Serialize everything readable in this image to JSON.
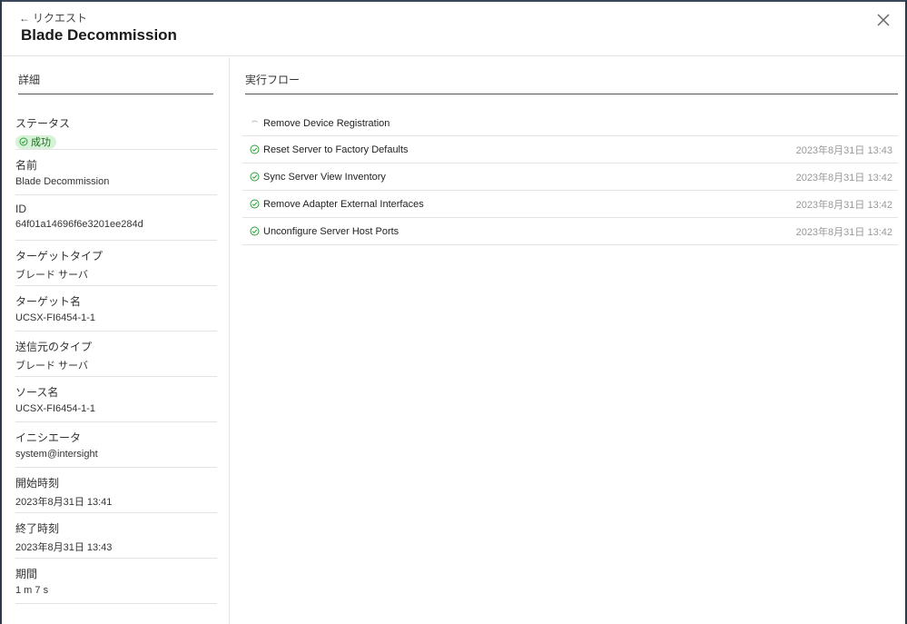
{
  "header": {
    "back_label": "リクエスト",
    "title": "Blade Decommission"
  },
  "details": {
    "heading": "詳細",
    "status": {
      "label": "ステータス",
      "value": "成功"
    },
    "fields": [
      {
        "label": "名前",
        "value": "Blade Decommission"
      },
      {
        "label": "ID",
        "value": "64f01a14696f6e3201ee284d"
      },
      {
        "label": "ターゲットタイプ",
        "value": "ブレード サーバ"
      },
      {
        "label": "ターゲット名",
        "value": "UCSX-FI6454-1-1"
      },
      {
        "label": "送信元のタイプ",
        "value": "ブレード サーバ"
      },
      {
        "label": "ソース名",
        "value": "UCSX-FI6454-1-1"
      },
      {
        "label": "イニシエータ",
        "value": "system@intersight"
      },
      {
        "label": "開始時刻",
        "value": "2023年8月31日 13:41"
      },
      {
        "label": "終了時刻",
        "value": "2023年8月31日 13:43"
      },
      {
        "label": "期間",
        "value": "1 m 7 s"
      }
    ]
  },
  "flow": {
    "heading": "実行フロー",
    "steps": [
      {
        "name": "Remove Device Registration",
        "time": "",
        "icon": "spinner-icon"
      },
      {
        "name": "Reset Server to Factory Defaults",
        "time": "2023年8月31日 13:43",
        "icon": "check-circle-icon"
      },
      {
        "name": "Sync Server View Inventory",
        "time": "2023年8月31日 13:42",
        "icon": "check-circle-icon"
      },
      {
        "name": "Remove Adapter External Interfaces",
        "time": "2023年8月31日 13:42",
        "icon": "check-circle-icon"
      },
      {
        "name": "Unconfigure Server Host Ports",
        "time": "2023年8月31日 13:42",
        "icon": "check-circle-icon"
      }
    ]
  },
  "colors": {
    "success": "#2e9b3a",
    "badge_bg": "#d7f3d7"
  }
}
